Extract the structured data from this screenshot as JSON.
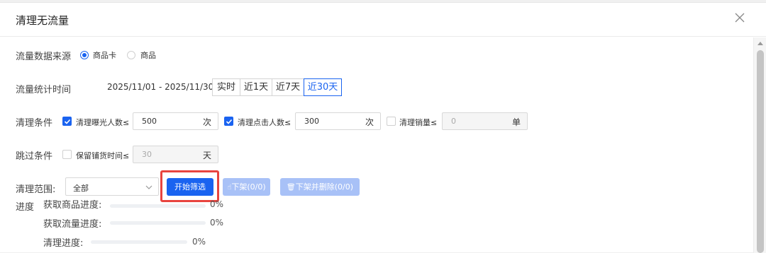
{
  "dialog": {
    "title": "清理无流量",
    "close_icon": "close-icon"
  },
  "source": {
    "label": "流量数据来源",
    "options": [
      {
        "label": "商品卡",
        "checked": true
      },
      {
        "label": "商品",
        "checked": false
      }
    ]
  },
  "time": {
    "label": "流量统计时间",
    "range": "2025/11/01 - 2025/11/30",
    "tabs": [
      {
        "label": "实时",
        "active": false
      },
      {
        "label": "近1天",
        "active": false
      },
      {
        "label": "近7天",
        "active": false
      },
      {
        "label": "近30天",
        "active": true
      }
    ]
  },
  "conditions": {
    "label": "清理条件",
    "items": [
      {
        "label": "清理曝光人数≤",
        "checked": true,
        "value": "500",
        "unit": "次",
        "disabled": false
      },
      {
        "label": "清理点击人数≤",
        "checked": true,
        "value": "300",
        "unit": "次",
        "disabled": false
      },
      {
        "label": "清理销量≤",
        "checked": false,
        "value": "0",
        "unit": "单",
        "disabled": true
      }
    ]
  },
  "skip": {
    "label": "跳过条件",
    "item": {
      "label": "保留铺货时间≤",
      "checked": false,
      "value": "30",
      "unit": "天",
      "disabled": true
    }
  },
  "scope": {
    "label": "清理范围:",
    "select_value": "全部",
    "buttons": {
      "start": "开始筛选",
      "remove": "下架(0/0)",
      "remove_delete": "下架并删除(0/0)"
    }
  },
  "progress": {
    "label": "进度",
    "items": [
      {
        "label": "获取商品进度:",
        "value": "0%"
      },
      {
        "label": "获取流量进度:",
        "value": "0%"
      },
      {
        "label": "清理进度:",
        "value": "0%"
      }
    ]
  },
  "colors": {
    "accent": "#1a63f0",
    "highlight": "#e8443f"
  }
}
